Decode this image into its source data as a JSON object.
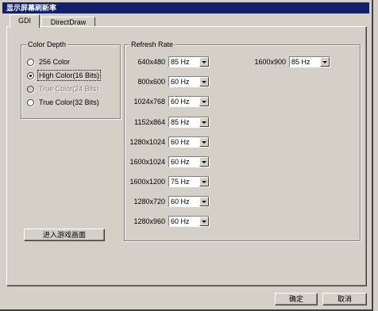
{
  "window": {
    "title": "显示屏幕刷新率"
  },
  "tabs": [
    {
      "label": "GDI",
      "active": true
    },
    {
      "label": "DirectDraw",
      "active": false
    }
  ],
  "color_depth": {
    "label": "Color Depth",
    "options": [
      {
        "label": "256 Color",
        "checked": false,
        "disabled": false
      },
      {
        "label": "High Color(16 Bits)",
        "checked": true,
        "disabled": false
      },
      {
        "label": "True Color(24 Bits)",
        "checked": false,
        "disabled": true
      },
      {
        "label": "True Color(32 Bits)",
        "checked": false,
        "disabled": false
      }
    ]
  },
  "refresh_rate": {
    "label": "Refresh Rate",
    "rows": [
      {
        "resolution": "640x480",
        "rate": "85 Hz"
      },
      {
        "resolution": "800x600",
        "rate": "60 Hz"
      },
      {
        "resolution": "1024x768",
        "rate": "60 Hz"
      },
      {
        "resolution": "1152x864",
        "rate": "85 Hz"
      },
      {
        "resolution": "1280x1024",
        "rate": "60 Hz"
      },
      {
        "resolution": "1600x1024",
        "rate": "60 Hz"
      },
      {
        "resolution": "1600x1200",
        "rate": "75 Hz"
      },
      {
        "resolution": "1280x720",
        "rate": "60 Hz"
      },
      {
        "resolution": "1280x960",
        "rate": "60 Hz"
      }
    ],
    "right_rows": [
      {
        "resolution": "1600x900",
        "rate": "85 Hz"
      }
    ]
  },
  "action_button": {
    "label": "进入游戏画面"
  },
  "footer": {
    "ok_label": "确定",
    "cancel_label": "取消"
  },
  "colors": {
    "title_bar": "#10206a",
    "dialog_bg": "#d4d0c8"
  }
}
